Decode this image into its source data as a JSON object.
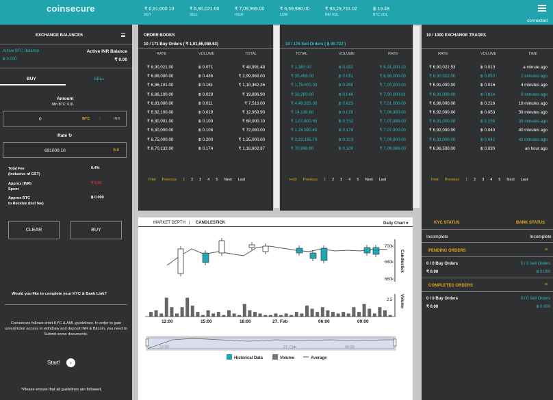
{
  "header": {
    "logo": "coinsecure",
    "stats": [
      {
        "value": "₹ 6,91,000.10",
        "label": "BUY"
      },
      {
        "value": "₹ 6,90,021.00",
        "label": "SELL"
      },
      {
        "value": "₹ 7,09,999.00",
        "label": "HIGH"
      },
      {
        "value": "₹ 6,69,980.00",
        "label": "LOW"
      },
      {
        "value": "₹ 93,29,711.02",
        "label": "INR VOL"
      },
      {
        "value": "฿ 13.48",
        "label": "BTC VOL"
      }
    ],
    "status": "connected"
  },
  "balances": {
    "title": "EXCHANGE BALANCES",
    "btc_label": "Active BTC Balance",
    "btc_value": "฿ 0.000",
    "inr_label": "Active INR Balance",
    "inr_value": "₹ 0.00"
  },
  "trade": {
    "tab_buy": "BUY",
    "tab_sell": "SELL",
    "amount_label": "Amount",
    "min_btc": "Min BTC: 0.01",
    "amount_value": "0",
    "btc": "BTC",
    "inr": "INR",
    "rate_label": "Rate",
    "rate_value": "691000.10",
    "rate_unit": "INR",
    "fee_label": "Total Fee",
    "fee_sub": "(Inclusive of GST)",
    "fee_value": "0.4%",
    "spent_label": "Approx (INR)",
    "spent_sub": "Spent",
    "spent_value": "₹ 0.00",
    "receive_label": "Approx BTC",
    "receive_sub": "to Receive (Incl fee)",
    "receive_value": "฿ 0.000",
    "clear": "CLEAR",
    "buy": "BUY"
  },
  "kyc": {
    "question": "Would you like to complete your KYC & Bank Link?",
    "text": "Coinsecure follows strict KYC & AML guidelines. In order to gain unrestricted access to withdraw and deposit INR & Bitcoin, you need to Submit some documents.",
    "start": "Start!",
    "note": "*Please ensure that all guidelines are followed."
  },
  "orderbook": {
    "title": "ORDER BOOKS",
    "buy_sub": "10 / 171 Buy Orders ( ₹ 1,01,66,086.63)",
    "sell_sub": "10 / 176 Sell Orders ( ฿ 40.722 )",
    "cols_buy": [
      "RATE",
      "VOLUME",
      "TOTAL"
    ],
    "cols_sell": [
      "TOTAL",
      "VOLUME",
      "RATE"
    ],
    "buy": [
      [
        "₹ 6,90,021.00",
        "฿ 0.071",
        "₹ 48,991.49"
      ],
      [
        "₹ 6,88,000.00",
        "฿ 0.436",
        "₹ 2,99,968.00"
      ],
      [
        "₹ 6,86,101.00",
        "฿ 0.161",
        "₹ 1,10,462.26"
      ],
      [
        "₹ 6,86,100.00",
        "฿ 0.029",
        "₹ 19,896.90"
      ],
      [
        "₹ 6,83,000.00",
        "฿ 0.011",
        "₹ 7,513.00"
      ],
      [
        "₹ 6,82,100.00",
        "฿ 0.019",
        "₹ 12,959.90"
      ],
      [
        "₹ 6,80,001.00",
        "฿ 0.100",
        "₹ 68,000.10"
      ],
      [
        "₹ 6,80,000.00",
        "฿ 0.106",
        "₹ 72,080.00"
      ],
      [
        "₹ 6,75,000.00",
        "฿ 0.200",
        "₹ 1,35,000.00"
      ],
      [
        "₹ 6,70,132.00",
        "฿ 0.174",
        "₹ 1,16,602.97"
      ]
    ],
    "sell": [
      [
        "₹ 1,382.00",
        "฿ 0.002",
        "₹ 6,91,000.10"
      ],
      [
        "₹ 35,496.00",
        "฿ 0.051",
        "₹ 6,96,000.00"
      ],
      [
        "₹ 1,75,000.00",
        "฿ 0.250",
        "₹ 7,00,000.00"
      ],
      [
        "₹ 32,200.00",
        "฿ 0.046",
        "₹ 7,00,000.01"
      ],
      [
        "₹ 4,49,925.00",
        "฿ 0.625",
        "₹ 7,01,000.00"
      ],
      [
        "₹ 14,139.80",
        "฿ 0.020",
        "₹ 7,06,990.00"
      ],
      [
        "₹ 1,07,600.65",
        "฿ 0.152",
        "₹ 7,07,899.00"
      ],
      [
        "₹ 1,24,590.40",
        "฿ 0.176",
        "₹ 7,07,900.00"
      ],
      [
        "₹ 2,22,195.70",
        "฿ 0.313",
        "₹ 7,09,900.00"
      ],
      [
        "₹ 70,999.90",
        "฿ 0.100",
        "₹ 7,09,989.00"
      ]
    ],
    "pager": [
      "First",
      "Previous",
      "1",
      "2",
      "3",
      "4",
      "5",
      "Next",
      "Last"
    ]
  },
  "trades": {
    "title": "10 / 1000 EXCHANGE TRADES",
    "cols": [
      "RATE",
      "VOLUME",
      "TIME"
    ],
    "rows": [
      [
        "₹ 6,90,021.53",
        "฿ 0.013",
        "a minute ago"
      ],
      [
        "₹ 6,90,022.00",
        "฿ 0.050",
        "2 minutes ago"
      ],
      [
        "₹ 6,91,000.00",
        "฿ 0.016",
        "4 minutes ago"
      ],
      [
        "₹ 6,91,000.00",
        "฿ 0.014",
        "9 minutes ago"
      ],
      [
        "₹ 6,96,000.00",
        "฿ 0.216",
        "18 minutes ago"
      ],
      [
        "₹ 6,92,000.00",
        "฿ 0.053",
        "39 minutes ago"
      ],
      [
        "₹ 6,91,000.00",
        "฿ 0.159",
        "39 minutes ago"
      ],
      [
        "₹ 6,92,000.00",
        "฿ 0.040",
        "40 minutes ago"
      ],
      [
        "₹ 6,92,000.00",
        "฿ 0.042",
        "41 minutes ago"
      ],
      [
        "₹ 6,96,500.00",
        "฿ 0.030",
        "an hour ago"
      ]
    ],
    "teal_rows": [
      1,
      3,
      6,
      8
    ]
  },
  "chart": {
    "tab_depth": "MARKET DEPTH",
    "sep": "|",
    "tab_candle": "CANDLESTICK",
    "period": "Daily Chart",
    "ylabel": "Candlestick",
    "vlabel": "Volume",
    "yticks": [
      "700k",
      "680k",
      "660k"
    ],
    "vtick": "2.5",
    "xticks": [
      "12:00",
      "15:00",
      "18:00",
      "27. Feb",
      "06:00",
      "09:00"
    ],
    "nav_ticks": [
      "12:00",
      "27. Feb",
      "06:00"
    ],
    "legend": [
      "Historical Data",
      "Volume",
      "Average"
    ]
  },
  "chart_data": {
    "type": "candlestick",
    "ylabel": "Candlestick",
    "ylim": [
      660000,
      705000
    ],
    "x": [
      "12:00",
      "15:00",
      "18:00",
      "27. Feb",
      "06:00",
      "09:00"
    ],
    "candles_teal": [
      [
        296,
        370,
        384
      ],
      [
        433,
        363,
        370
      ],
      [
        453,
        370,
        378
      ],
      [
        469,
        363,
        381
      ],
      [
        532,
        362,
        370
      ],
      [
        545,
        362,
        372
      ]
    ],
    "candles_white": [
      [
        260,
        364,
        400
      ],
      [
        320,
        352,
        370
      ],
      [
        364,
        358,
        362
      ],
      [
        384,
        360,
        368
      ]
    ],
    "volume": [
      3,
      4,
      2,
      12,
      6,
      2,
      6,
      12,
      7,
      3,
      1,
      4,
      2,
      3,
      1,
      4,
      2,
      1,
      8,
      4,
      3,
      2,
      1,
      1,
      2,
      1,
      2,
      1,
      3,
      2,
      7,
      5,
      3,
      6,
      4,
      3,
      2,
      3,
      2,
      6,
      3,
      8,
      5,
      2,
      6,
      4,
      1
    ]
  },
  "status": {
    "kyc_label": "KYC STATUS",
    "kyc_value": "Incomplete",
    "bank_label": "BANK STATUS",
    "bank_value": "Incomplete",
    "pending_title": "PENDING ORDERS",
    "pending_buy": "0 / 0 Buy Orders",
    "pending_buy_val": "₹ 0.00",
    "pending_sell": "0 / 0 Sell Orders",
    "pending_sell_val": "฿ 0.000",
    "completed_title": "COMPLETED ORDERS",
    "completed_buy": "0 / 0 Buy Orders",
    "completed_buy_val": "₹ 0.00",
    "completed_sell": "0 / 0 Sell Orders",
    "completed_sell_val": "฿ 0.000"
  }
}
